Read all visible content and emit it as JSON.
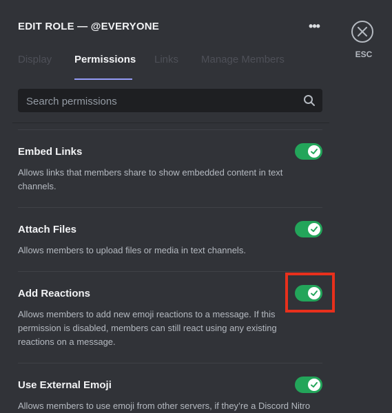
{
  "header": {
    "title": "EDIT ROLE — @EVERYONE",
    "more_label": "•••",
    "close_label": "ESC"
  },
  "tabs": [
    {
      "label": "Display",
      "active": false
    },
    {
      "label": "Permissions",
      "active": true
    },
    {
      "label": "Links",
      "active": false
    },
    {
      "label": "Manage Members",
      "active": false
    }
  ],
  "search": {
    "placeholder": "Search permissions",
    "value": ""
  },
  "permissions": [
    {
      "title": "Embed Links",
      "description": "Allows links that members share to show embedded content in text channels.",
      "enabled": true
    },
    {
      "title": "Attach Files",
      "description": "Allows members to upload files or media in text channels.",
      "enabled": true
    },
    {
      "title": "Add Reactions",
      "description": "Allows members to add new emoji reactions to a message. If this permission is disabled, members can still react using any existing reactions on a message.",
      "enabled": true,
      "highlighted": true
    },
    {
      "title": "Use External Emoji",
      "description": "Allows members to use emoji from other servers, if they’re a Discord Nitro",
      "enabled": true
    }
  ],
  "colors": {
    "background": "#313338",
    "toggle_on": "#23a55a",
    "tab_underline": "#949cf7",
    "highlight": "#e8301c"
  }
}
